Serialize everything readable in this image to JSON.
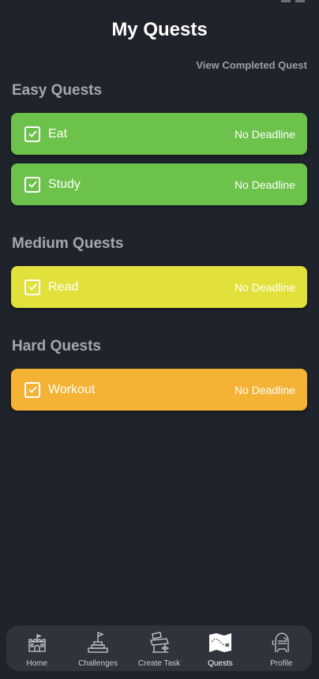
{
  "header": {
    "title": "My Quests",
    "view_completed": "View Completed Quest"
  },
  "sections": {
    "easy": {
      "title": "Easy Quests",
      "color": "#6cc24a",
      "quests": [
        {
          "name": "Eat",
          "deadline": "No Deadline"
        },
        {
          "name": "Study",
          "deadline": "No Deadline"
        }
      ]
    },
    "medium": {
      "title": "Medium Quests",
      "color": "#e2e13c",
      "quests": [
        {
          "name": "Read",
          "deadline": "No Deadline"
        }
      ]
    },
    "hard": {
      "title": "Hard Quests",
      "color": "#f5b335",
      "quests": [
        {
          "name": "Workout",
          "deadline": "No Deadline"
        }
      ]
    }
  },
  "nav": {
    "active": "Quests",
    "items": [
      {
        "label": "Home",
        "icon": "castle-icon"
      },
      {
        "label": "Challenges",
        "icon": "flag-podium-icon"
      },
      {
        "label": "Create Task",
        "icon": "writing-desk-icon"
      },
      {
        "label": "Quests",
        "icon": "treasure-map-icon"
      },
      {
        "label": "Profile",
        "icon": "knight-helmet-icon"
      }
    ]
  }
}
